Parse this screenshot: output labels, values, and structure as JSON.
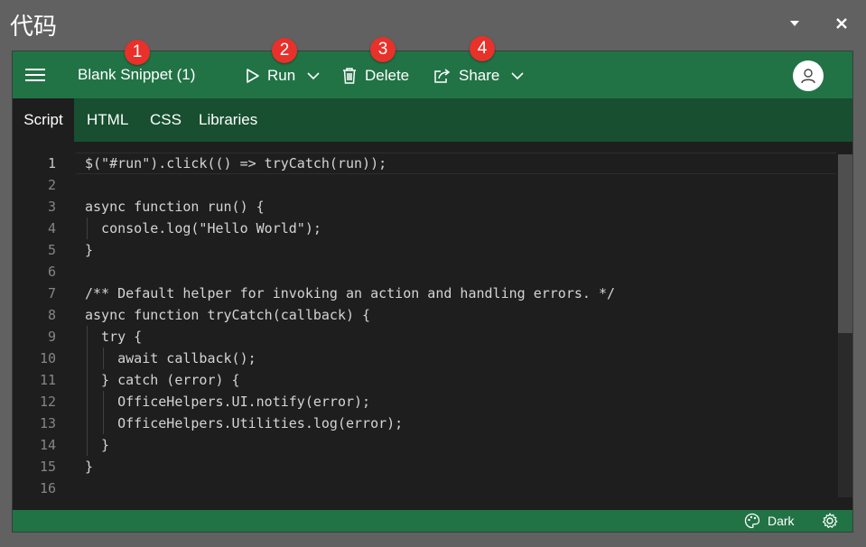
{
  "pane": {
    "title": "代码"
  },
  "header": {
    "snippet_name": "Blank Snippet (1)",
    "run_label": "Run",
    "delete_label": "Delete",
    "share_label": "Share"
  },
  "markers": [
    "1",
    "2",
    "3",
    "4"
  ],
  "tabs": [
    {
      "label": "Script",
      "active": true
    },
    {
      "label": "HTML",
      "active": false
    },
    {
      "label": "CSS",
      "active": false
    },
    {
      "label": "Libraries",
      "active": false
    }
  ],
  "editor": {
    "lines": [
      {
        "num": "1",
        "text": "$(\"#run\").click(() => tryCatch(run));"
      },
      {
        "num": "2",
        "text": ""
      },
      {
        "num": "3",
        "text": "async function run() {"
      },
      {
        "num": "4",
        "text": "  console.log(\"Hello World\");"
      },
      {
        "num": "5",
        "text": "}"
      },
      {
        "num": "6",
        "text": ""
      },
      {
        "num": "7",
        "text": "/** Default helper for invoking an action and handling errors. */"
      },
      {
        "num": "8",
        "text": "async function tryCatch(callback) {"
      },
      {
        "num": "9",
        "text": "  try {"
      },
      {
        "num": "10",
        "text": "    await callback();"
      },
      {
        "num": "11",
        "text": "  } catch (error) {"
      },
      {
        "num": "12",
        "text": "    OfficeHelpers.UI.notify(error);"
      },
      {
        "num": "13",
        "text": "    OfficeHelpers.Utilities.log(error);"
      },
      {
        "num": "14",
        "text": "  }"
      },
      {
        "num": "15",
        "text": "}"
      },
      {
        "num": "16",
        "text": ""
      }
    ]
  },
  "status": {
    "theme_label": "Dark"
  },
  "colors": {
    "brand": "#217346",
    "tab_bar": "#174f30",
    "editor_bg": "#1e1e1e",
    "marker": "#e8312a"
  },
  "icons": {
    "menu": "hamburger-icon",
    "run": "play-icon",
    "run_more": "chevron-down-icon",
    "delete": "trash-icon",
    "share": "share-icon",
    "share_more": "chevron-down-icon",
    "user": "user-icon",
    "theme": "palette-icon",
    "settings": "gear-icon"
  }
}
